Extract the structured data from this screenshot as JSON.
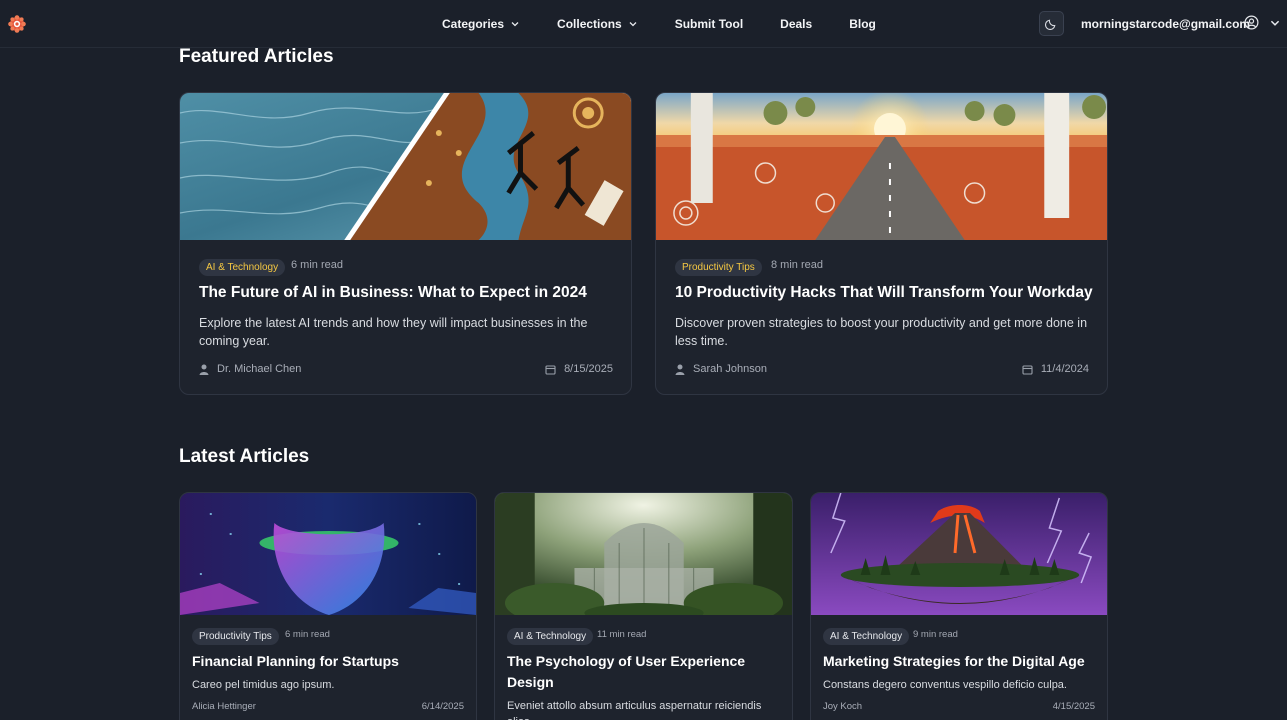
{
  "header": {
    "nav": [
      {
        "label": "Categories",
        "dropdown": true
      },
      {
        "label": "Collections",
        "dropdown": true
      },
      {
        "label": "Submit Tool",
        "dropdown": false
      },
      {
        "label": "Deals",
        "dropdown": false
      },
      {
        "label": "Blog",
        "dropdown": false
      }
    ],
    "email": "morningstarcode@gmail.com",
    "icons": {
      "logo": "flower-gear-logo",
      "theme": "moon-icon",
      "user": "user-circle-icon",
      "menu": "chevron-down-icon"
    }
  },
  "featured": {
    "title": "Featured Articles",
    "articles": [
      {
        "category": "AI & Technology",
        "read_time": "6 min read",
        "title": "The Future of AI in Business: What to Expect in 2024",
        "description": "Explore the latest AI trends and how they will impact businesses in the coming year.",
        "author": "Dr. Michael Chen",
        "date": "8/15/2025"
      },
      {
        "category": "Productivity Tips",
        "read_time": "8 min read",
        "title": "10 Productivity Hacks That Will Transform Your Workday",
        "description": "Discover proven strategies to boost your productivity and get more done in less time.",
        "author": "Sarah Johnson",
        "date": "11/4/2024"
      }
    ]
  },
  "latest": {
    "title": "Latest Articles",
    "articles": [
      {
        "category": "Productivity Tips",
        "read_time": "6 min read",
        "title": "Financial Planning for Startups",
        "description": "Careo pel timidus ago ipsum.",
        "author": "Alicia Hettinger",
        "date": "6/14/2025"
      },
      {
        "category": "AI & Technology",
        "read_time": "11 min read",
        "title": "The Psychology of User Experience Design",
        "description": "Eveniet attollo absum articulus aspernatur reiciendis alias.",
        "author": "",
        "date": ""
      },
      {
        "category": "AI & Technology",
        "read_time": "9 min read",
        "title": "Marketing Strategies for the Digital Age",
        "description": "Constans degero conventus vespillo deficio culpa.",
        "author": "Joy Koch",
        "date": "4/15/2025"
      }
    ]
  },
  "colors": {
    "background": "#1b202a",
    "card": "#1e232d",
    "badge_accent": "#f5c842"
  }
}
